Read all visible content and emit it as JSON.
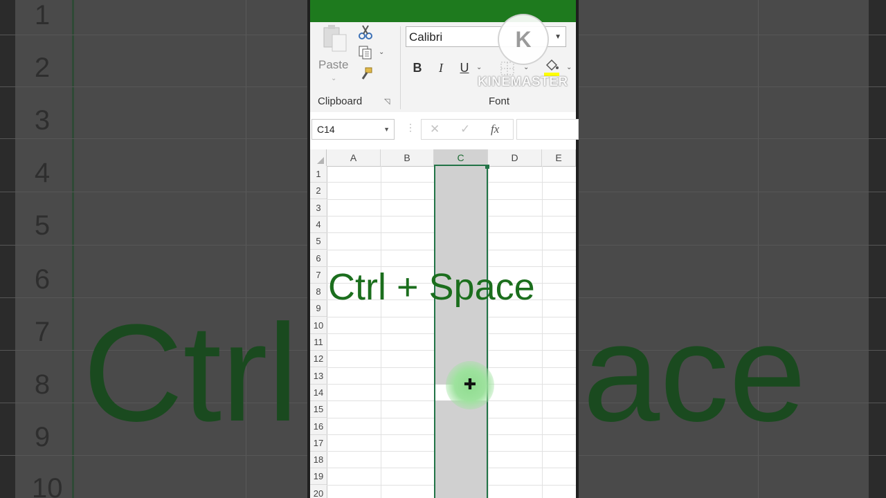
{
  "ribbon": {
    "paste_label": "Paste",
    "clipboard_group": "Clipboard",
    "font_group": "Font",
    "font_name": "Calibri",
    "bold": "B",
    "italic": "I",
    "underline": "U"
  },
  "formula_bar": {
    "name_box": "C14",
    "cancel_icon": "✕",
    "enter_icon": "✓",
    "fx_label": "fx",
    "formula_value": ""
  },
  "sheet": {
    "columns": [
      "A",
      "B",
      "C",
      "D",
      "E"
    ],
    "selected_column": "C",
    "rows": [
      "1",
      "2",
      "3",
      "4",
      "5",
      "6",
      "7",
      "8",
      "9",
      "10",
      "11",
      "12",
      "13",
      "14",
      "15",
      "16",
      "17",
      "18",
      "19",
      "20"
    ],
    "active_cell": "C14"
  },
  "overlay": {
    "shortcut_text": "Ctrl + Space"
  },
  "watermark": {
    "text": "KINEMASTER",
    "logo_letter": "K"
  },
  "background": {
    "rows": [
      "1",
      "2",
      "3",
      "4",
      "5",
      "6",
      "7",
      "8",
      "9",
      "10"
    ],
    "left_text": "Ctrl",
    "right_text": "ace"
  },
  "colors": {
    "excel_green": "#217346",
    "title_green": "#1e7a1e",
    "overlay_green": "#1b6e1d"
  }
}
